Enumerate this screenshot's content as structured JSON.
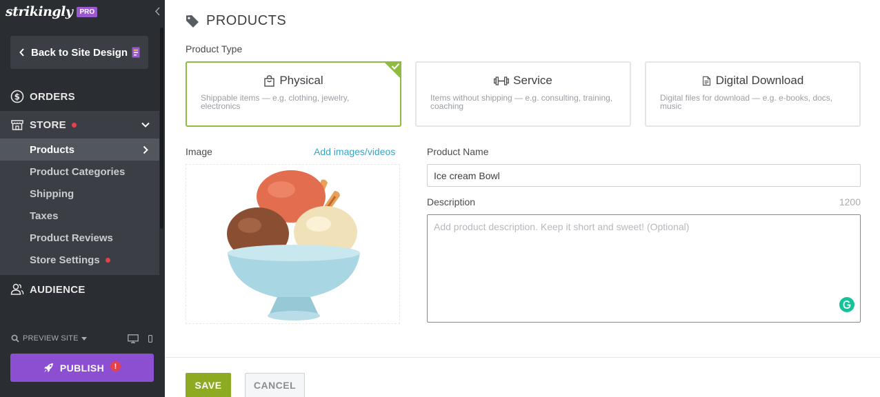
{
  "sidebar": {
    "logo": "strikingly",
    "plan_badge": "PRO",
    "back_label": "Back to Site Design",
    "nav": {
      "orders": "ORDERS",
      "store": "STORE",
      "audience": "AUDIENCE"
    },
    "store_items": [
      {
        "label": "Products"
      },
      {
        "label": "Product Categories"
      },
      {
        "label": "Shipping"
      },
      {
        "label": "Taxes"
      },
      {
        "label": "Product Reviews"
      },
      {
        "label": "Store Settings"
      }
    ],
    "preview_label": "PREVIEW SITE",
    "publish_label": "PUBLISH",
    "publish_alert": "!"
  },
  "main": {
    "title": "PRODUCTS",
    "product_type_label": "Product Type",
    "product_types": [
      {
        "title": "Physical",
        "desc": "Shippable items — e.g. clothing, jewelry, electronics",
        "icon": "shopping-bag-icon",
        "selected": true
      },
      {
        "title": "Service",
        "desc": "Items without shipping — e.g. consulting, training, coaching",
        "icon": "dumbbell-icon",
        "selected": false
      },
      {
        "title": "Digital Download",
        "desc": "Digital files for download — e.g. e-books, docs, music",
        "icon": "document-icon",
        "selected": false
      }
    ],
    "image_label": "Image",
    "add_media_link": "Add images/videos",
    "product_name_label": "Product Name",
    "product_name_value": "Ice cream Bowl",
    "description_label": "Description",
    "description_counter": "1200",
    "description_placeholder": "Add product description. Keep it short and sweet! (Optional)",
    "save_label": "SAVE",
    "cancel_label": "CANCEL"
  },
  "colors": {
    "sidebar_bg": "#2a2d31",
    "publish": "#8d4fd1",
    "selected_border": "#8fbc3f",
    "save": "#8dab22",
    "link": "#36a5c6",
    "notification": "#e5404d"
  }
}
